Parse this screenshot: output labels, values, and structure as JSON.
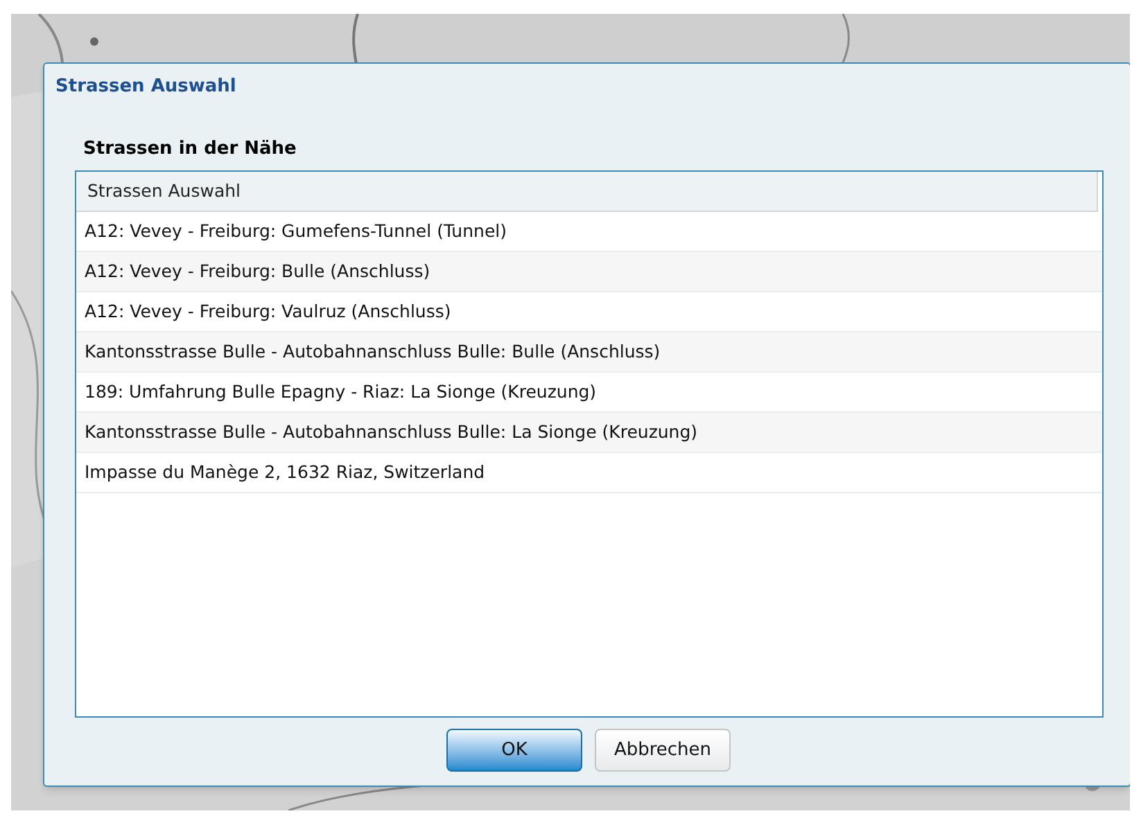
{
  "dialog": {
    "title": "Strassen Auswahl",
    "section_label": "Strassen in der Nähe",
    "list": {
      "column": "Strassen Auswahl",
      "rows": [
        "A12: Vevey - Freiburg: Gumefens-Tunnel (Tunnel)",
        "A12: Vevey - Freiburg: Bulle (Anschluss)",
        "A12: Vevey - Freiburg: Vaulruz (Anschluss)",
        "Kantonsstrasse Bulle - Autobahnanschluss Bulle: Bulle (Anschluss)",
        "189: Umfahrung Bulle Epagny - Riaz: La Sionge (Kreuzung)",
        "Kantonsstrasse Bulle - Autobahnanschluss Bulle: La Sionge (Kreuzung)",
        "Impasse du Manège 2, 1632 Riaz, Switzerland"
      ]
    },
    "buttons": [
      {
        "label": "OK",
        "kind": "primary"
      },
      {
        "label": "Abbrechen",
        "kind": "secondary"
      }
    ]
  }
}
